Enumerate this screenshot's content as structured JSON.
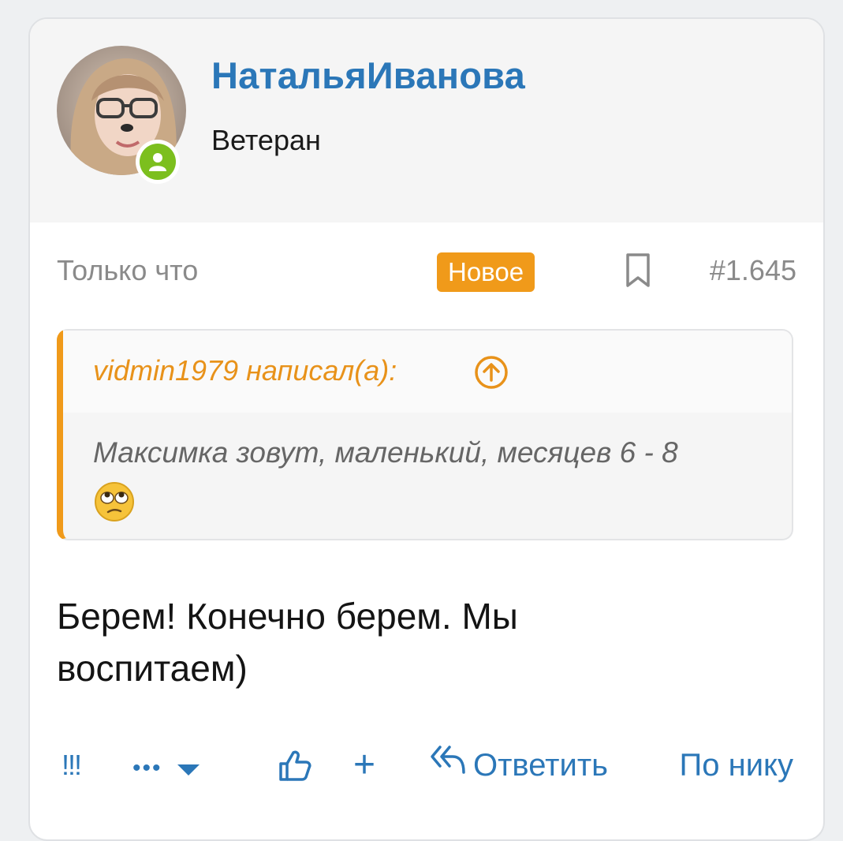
{
  "colors": {
    "accent": "#2b77b8",
    "badge_orange": "#f09a1a",
    "online_green": "#7cbf1e"
  },
  "author": {
    "name": "НатальяИванова",
    "title": "Ветеран",
    "status_icon": "user-online-icon"
  },
  "meta": {
    "time": "Только что",
    "new_badge": "Новое",
    "post_number": "#1.645",
    "bookmark_icon": "bookmark-icon"
  },
  "quote": {
    "author": "vidmin1979 написал(а):",
    "jump_icon": "arrow-up-circle-icon",
    "text": "Максимка зовут, маленький, месяцев 6 - 8",
    "emoji": "🙄"
  },
  "post": {
    "text_line1": "Берем! Конечно берем. Мы",
    "text_line2": "воспитаем)"
  },
  "actions": {
    "report": "!!!",
    "more": "•••",
    "like_icon": "thumbs-up-icon",
    "add": "+",
    "reply": "Ответить",
    "reply_icon": "reply-icon",
    "by_nick": "По нику"
  }
}
